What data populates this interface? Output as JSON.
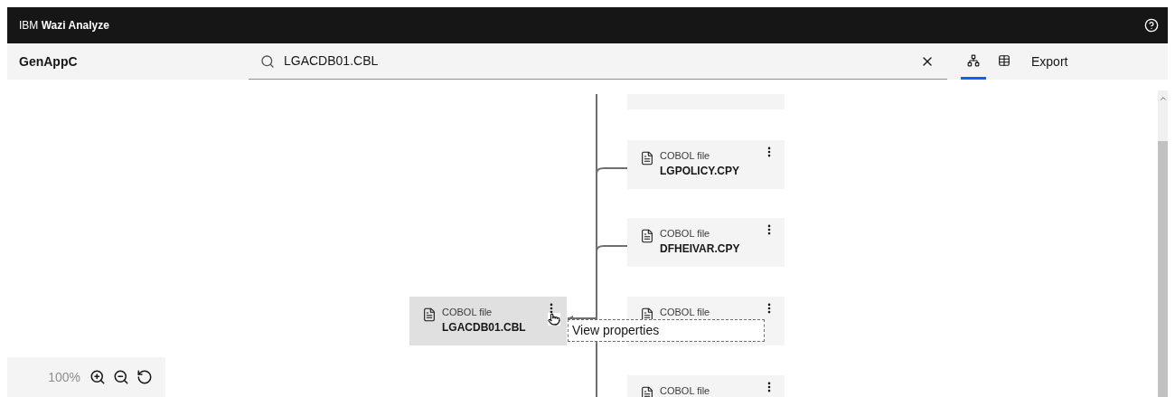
{
  "header": {
    "brand_prefix": "IBM",
    "brand_name": "Wazi Analyze"
  },
  "toolbar": {
    "project": "GenAppC",
    "search": {
      "value": "LGACDB01.CBL"
    },
    "view_tabs": [
      {
        "kind": "graph",
        "selected": true
      },
      {
        "kind": "table",
        "selected": false
      }
    ],
    "export": "Export"
  },
  "graph": {
    "source": {
      "type": "COBOL file",
      "name": "LGACDB01.CBL",
      "hovered": true
    },
    "nodes": [
      {
        "type": "COBOL file",
        "name": "LGPOLICY.CPY"
      },
      {
        "type": "COBOL file",
        "name": "DFHEIVAR.CPY"
      },
      {
        "type": "COBOL file"
      },
      {
        "type": "COBOL file"
      }
    ],
    "tooltip": "View properties"
  },
  "zoom": {
    "level_text": "100%"
  }
}
